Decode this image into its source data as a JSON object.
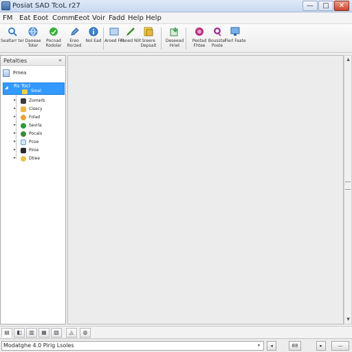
{
  "window": {
    "title": "Posiat SAD TcoL r27",
    "minimize_glyph": "—",
    "maximize_glyph": "□",
    "close_glyph": "✕"
  },
  "menu": [
    "FM",
    "Eat",
    "Eoot",
    "Comm",
    "Eeot",
    "Voir",
    "Fadd",
    "Help",
    "Help"
  ],
  "toolbar": [
    {
      "icon": "magnifier-icon",
      "label": "Sealtarr ter",
      "color": "#3b7fc4"
    },
    {
      "icon": "globe-icon",
      "label": "Daoeae Toter",
      "color": "#2a7ad0"
    },
    {
      "icon": "leaf-icon",
      "label": "Pocnad Rodolar",
      "color": "#2f9a2f"
    },
    {
      "icon": "pen-icon",
      "label": "Ereo Rorzed",
      "color": "#3f6fb0"
    },
    {
      "icon": "info-icon",
      "label": "Nol Ead",
      "color": "#2a7ad0"
    },
    {
      "icon": "square-icon",
      "label": "Aroed Fol",
      "color": "#4a8fd6"
    },
    {
      "icon": "pencil-icon",
      "label": "Paoed Nlit",
      "color": "#3a9a2a"
    },
    {
      "icon": "note-icon",
      "label": "Sreere Depsait",
      "color": "#e2b93c"
    },
    {
      "icon": "import-icon",
      "label": "Deseead Hriet",
      "color": "#3b9a5a"
    },
    {
      "icon": "record-icon",
      "label": "Peotad Fhtee",
      "color": "#b0307a"
    },
    {
      "icon": "pin-icon",
      "label": "Bousstar Poste",
      "color": "#9a2f8a"
    },
    {
      "icon": "monitor-icon",
      "label": "Flerl Faate",
      "color": "#4a8fd6"
    }
  ],
  "panel": {
    "title": "Petalties",
    "root_label": "Frnea",
    "selected_label": "Rs Tocl",
    "selected_child_label": "Smel",
    "items": [
      {
        "label": "Zomerb",
        "color": "#3a3a3a"
      },
      {
        "label": "Cisecy",
        "color": "#e8b84a"
      },
      {
        "label": "Folad",
        "color": "#e8a23a"
      },
      {
        "label": "Sevrla",
        "color": "#2e9a3a"
      },
      {
        "label": "Pocalo",
        "color": "#3a8a3a"
      },
      {
        "label": "Pcoe",
        "color": "#6a9ac8"
      },
      {
        "label": "Pinie",
        "color": "#2a2a2a"
      },
      {
        "label": "Dtiee",
        "color": "#e8c24a"
      }
    ]
  },
  "bottom_tabs": [
    "▤",
    "◧",
    "▥",
    "▦",
    "▧",
    "◬",
    "◍"
  ],
  "status": {
    "text": "Modatghe 4.0 Pirig Lsoles",
    "dropdown_glyph": "▾",
    "nav_left": "◂",
    "zoom": "88",
    "nav_right": "▸",
    "extra": "—"
  }
}
